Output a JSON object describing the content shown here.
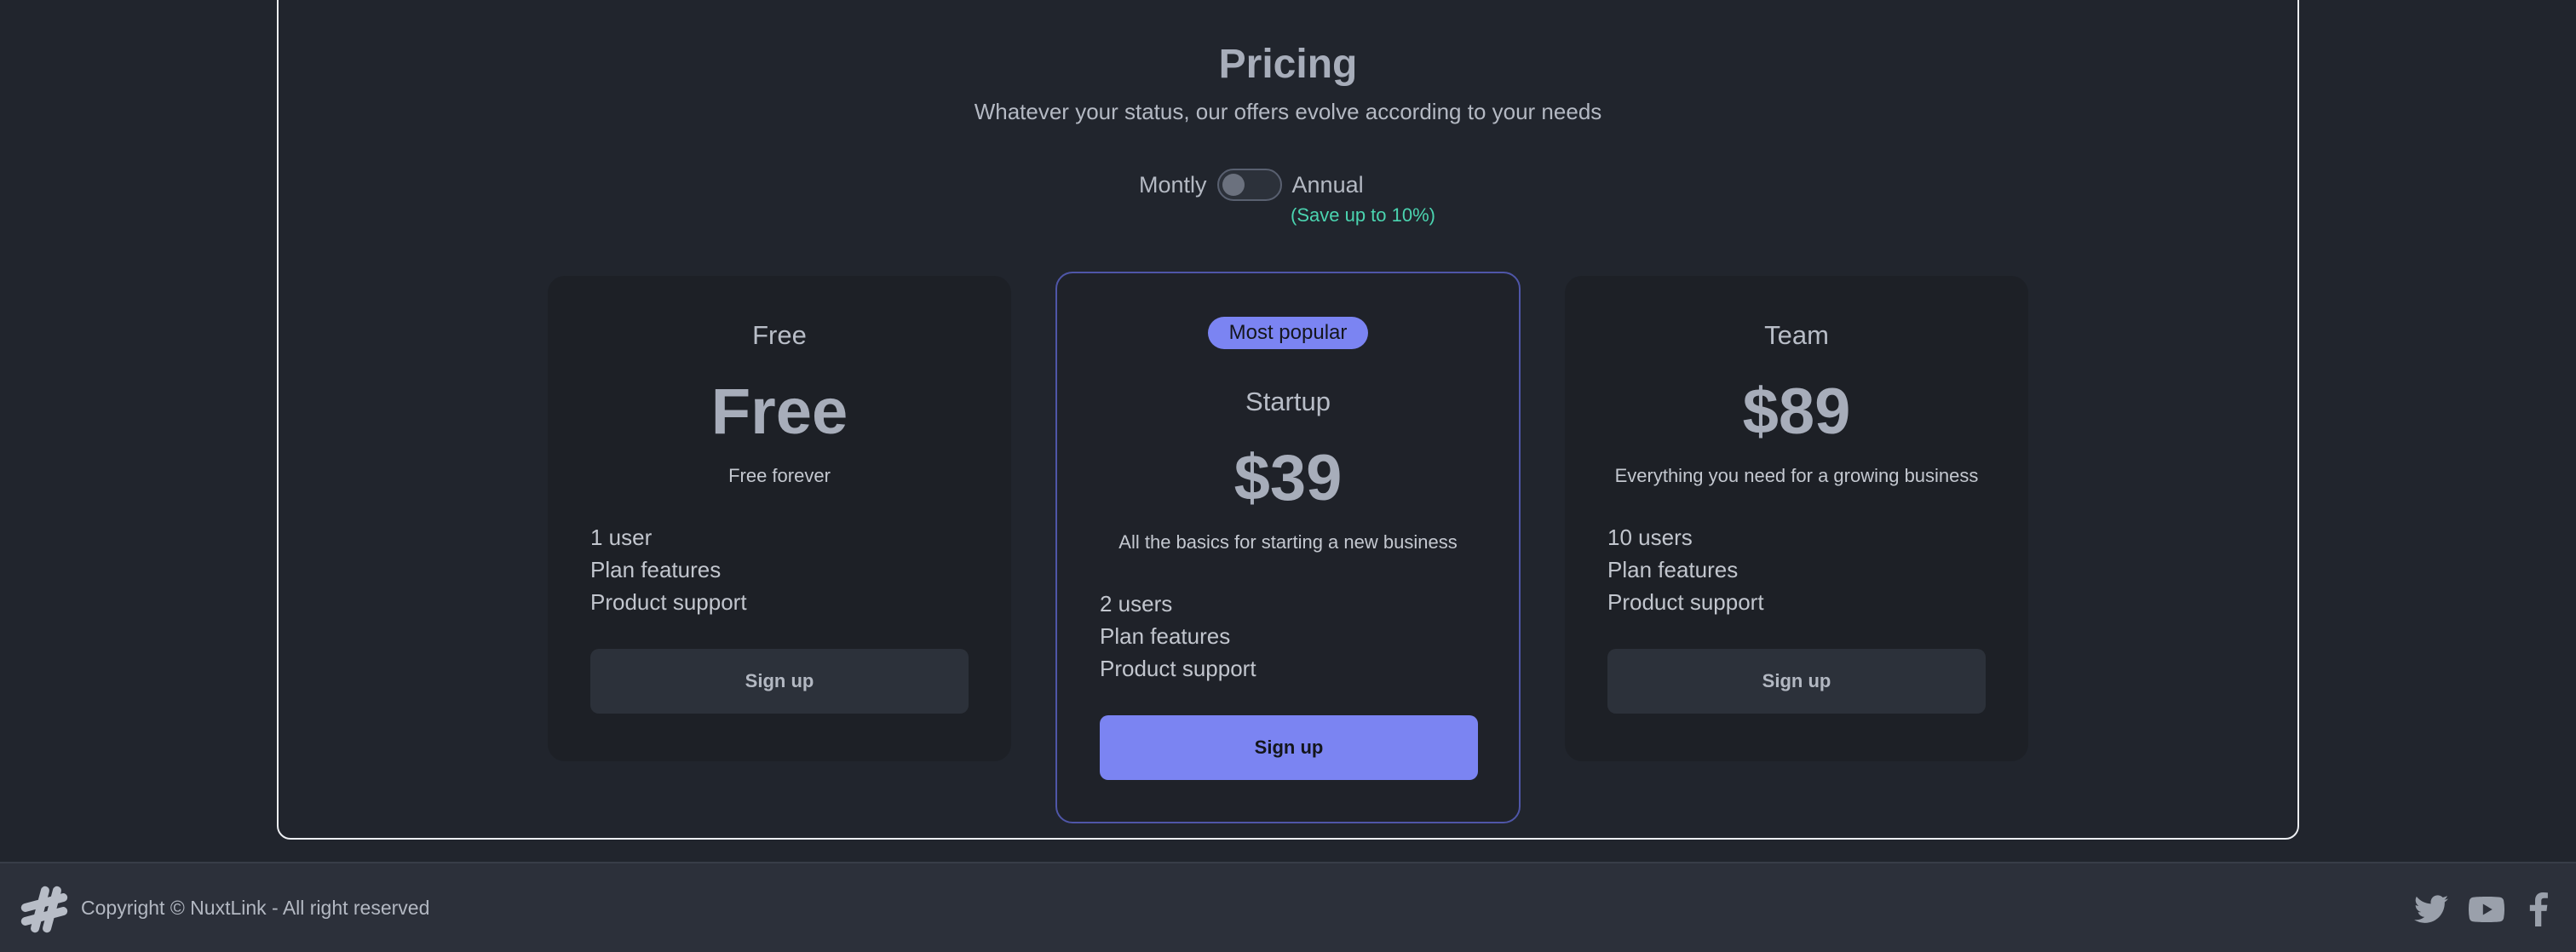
{
  "pricing": {
    "title": "Pricing",
    "subtitle": "Whatever your status, our offers evolve according to your needs"
  },
  "billing": {
    "monthly_label": "Montly",
    "annual_label": "Annual",
    "save_note": "(Save up to 10%)",
    "annual_selected": false
  },
  "plans": [
    {
      "name": "Free",
      "price": "Free",
      "description": "Free forever",
      "features": [
        "1 user",
        "Plan features",
        "Product support"
      ],
      "cta": "Sign up",
      "featured": false
    },
    {
      "badge": "Most popular",
      "name": "Startup",
      "price": "$39",
      "description": "All the basics for starting a new business",
      "features": [
        "2 users",
        "Plan features",
        "Product support"
      ],
      "cta": "Sign up",
      "featured": true
    },
    {
      "name": "Team",
      "price": "$89",
      "description": "Everything you need for a growing business",
      "features": [
        "10 users",
        "Plan features",
        "Product support"
      ],
      "cta": "Sign up",
      "featured": false
    }
  ],
  "footer": {
    "copyright": "Copyright © NuxtLink - All right reserved",
    "logo_icon": "hash-logo-icon",
    "social": [
      "twitter-icon",
      "youtube-icon",
      "facebook-icon"
    ]
  },
  "colors": {
    "background": "#21252d",
    "card": "#1d2026",
    "accent": "#7b84f2",
    "save_note": "#4bd4b0"
  }
}
